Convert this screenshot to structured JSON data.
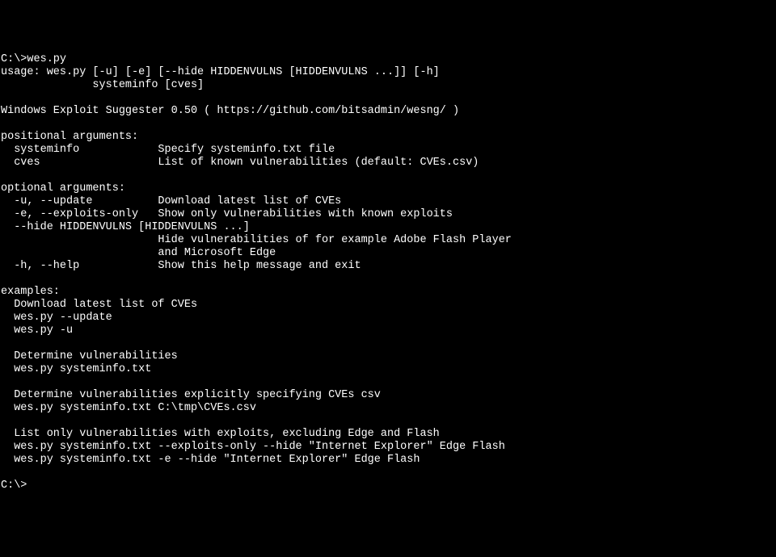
{
  "lines": [
    "C:\\>wes.py",
    "usage: wes.py [-u] [-e] [--hide HIDDENVULNS [HIDDENVULNS ...]] [-h]",
    "              systeminfo [cves]",
    "",
    "Windows Exploit Suggester 0.50 ( https://github.com/bitsadmin/wesng/ )",
    "",
    "positional arguments:",
    "  systeminfo            Specify systeminfo.txt file",
    "  cves                  List of known vulnerabilities (default: CVEs.csv)",
    "",
    "optional arguments:",
    "  -u, --update          Download latest list of CVEs",
    "  -e, --exploits-only   Show only vulnerabilities with known exploits",
    "  --hide HIDDENVULNS [HIDDENVULNS ...]",
    "                        Hide vulnerabilities of for example Adobe Flash Player",
    "                        and Microsoft Edge",
    "  -h, --help            Show this help message and exit",
    "",
    "examples:",
    "  Download latest list of CVEs",
    "  wes.py --update",
    "  wes.py -u",
    "",
    "  Determine vulnerabilities",
    "  wes.py systeminfo.txt",
    "",
    "  Determine vulnerabilities explicitly specifying CVEs csv",
    "  wes.py systeminfo.txt C:\\tmp\\CVEs.csv",
    "",
    "  List only vulnerabilities with exploits, excluding Edge and Flash",
    "  wes.py systeminfo.txt --exploits-only --hide \"Internet Explorer\" Edge Flash",
    "  wes.py systeminfo.txt -e --hide \"Internet Explorer\" Edge Flash",
    "",
    "C:\\>"
  ]
}
